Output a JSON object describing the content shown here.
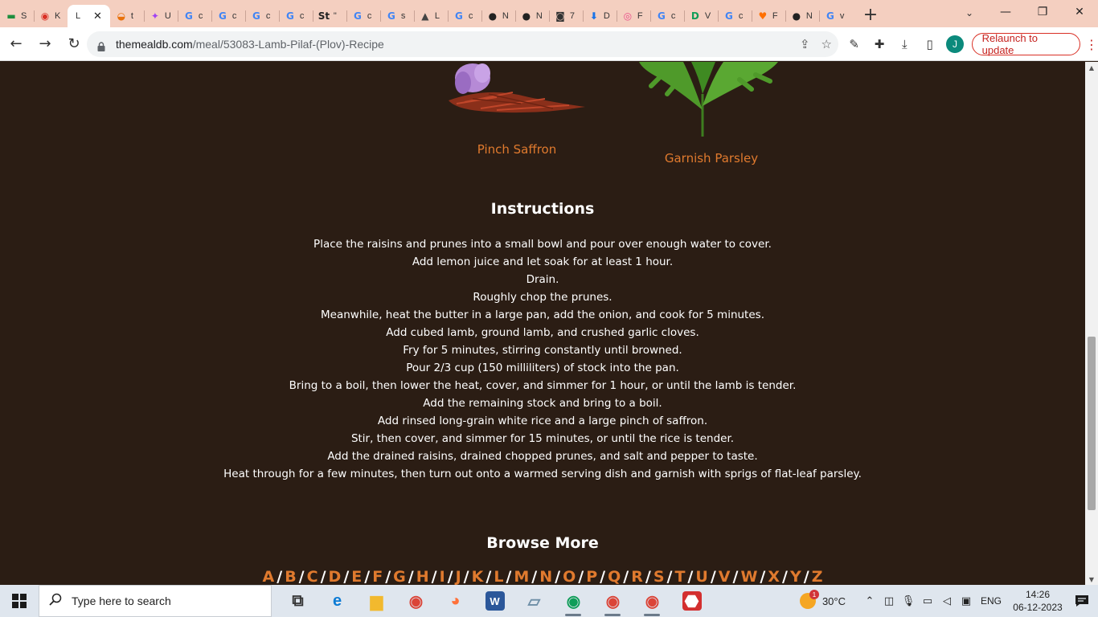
{
  "browser": {
    "tabs": [
      {
        "letter": "S",
        "color": "#1e8e3e",
        "glyph": "▬"
      },
      {
        "letter": "K",
        "color": "#d93025",
        "glyph": "◉"
      },
      {
        "letter": "L",
        "color": "#ffffff",
        "glyph": "",
        "active": true
      },
      {
        "letter": "t",
        "color": "#e8710a",
        "glyph": "◒"
      },
      {
        "letter": "U",
        "color": "#a142f4",
        "glyph": "✦"
      },
      {
        "letter": "c",
        "color": "#4285f4",
        "glyph": "G"
      },
      {
        "letter": "c",
        "color": "#4285f4",
        "glyph": "G"
      },
      {
        "letter": "c",
        "color": "#4285f4",
        "glyph": "G"
      },
      {
        "letter": "c",
        "color": "#4285f4",
        "glyph": "G"
      },
      {
        "letter": "\"",
        "color": "#222222",
        "glyph": "St"
      },
      {
        "letter": "c",
        "color": "#4285f4",
        "glyph": "G"
      },
      {
        "letter": "s",
        "color": "#4285f4",
        "glyph": "G"
      },
      {
        "letter": "L",
        "color": "#444444",
        "glyph": "▲"
      },
      {
        "letter": "c",
        "color": "#4285f4",
        "glyph": "G"
      },
      {
        "letter": "N",
        "color": "#222222",
        "glyph": "●"
      },
      {
        "letter": "N",
        "color": "#222222",
        "glyph": "●"
      },
      {
        "letter": "7",
        "color": "#333333",
        "glyph": "◙"
      },
      {
        "letter": "D",
        "color": "#1a73e8",
        "glyph": "⬇"
      },
      {
        "letter": "F",
        "color": "#ea4c89",
        "glyph": "◎"
      },
      {
        "letter": "c",
        "color": "#4285f4",
        "glyph": "G"
      },
      {
        "letter": "V",
        "color": "#0f9d58",
        "glyph": "D"
      },
      {
        "letter": "c",
        "color": "#4285f4",
        "glyph": "G"
      },
      {
        "letter": "F",
        "color": "#ff6f00",
        "glyph": "♥"
      },
      {
        "letter": "N",
        "color": "#222222",
        "glyph": "●"
      },
      {
        "letter": "v",
        "color": "#4285f4",
        "glyph": "G"
      }
    ],
    "new_tab": "+",
    "url_host": "themealdb.com",
    "url_path": "/meal/53083-Lamb-Pilaf-(Plov)-Recipe",
    "relaunch_label": "Relaunch to update",
    "profile_initial": "J"
  },
  "page": {
    "ingredients": [
      {
        "name": "Pinch Saffron",
        "image": "saffron"
      },
      {
        "name": "Garnish Parsley",
        "image": "parsley"
      }
    ],
    "instructions_title": "Instructions",
    "instructions": [
      "Place the raisins and prunes into a small bowl and pour over enough water to cover.",
      "Add lemon juice and let soak for at least 1 hour.",
      "Drain.",
      "Roughly chop the prunes.",
      "Meanwhile, heat the butter in a large pan, add the onion, and cook for 5 minutes.",
      "Add cubed lamb, ground lamb, and crushed garlic cloves.",
      "Fry for 5 minutes, stirring constantly until browned.",
      "Pour 2/3 cup (150 milliliters) of stock into the pan.",
      "Bring to a boil, then lower the heat, cover, and simmer for 1 hour, or until the lamb is tender.",
      "Add the remaining stock and bring to a boil.",
      "Add rinsed long-grain white rice and a large pinch of saffron.",
      "Stir, then cover, and simmer for 15 minutes, or until the rice is tender.",
      "Add the drained raisins, drained chopped prunes, and salt and pepper to taste.",
      "Heat through for a few minutes, then turn out onto a warmed serving dish and garnish with sprigs of flat-leaf parsley."
    ],
    "browse_title": "Browse More",
    "letters": [
      "A",
      "B",
      "C",
      "D",
      "E",
      "F",
      "G",
      "H",
      "I",
      "J",
      "K",
      "L",
      "M",
      "N",
      "O",
      "P",
      "Q",
      "R",
      "S",
      "T",
      "U",
      "V",
      "W",
      "X",
      "Y",
      "Z"
    ],
    "accent_color": "#e07a2e",
    "background_color": "#2b1d14"
  },
  "taskbar": {
    "search_placeholder": "Type here to search",
    "weather_temp": "30°C",
    "weather_badge": "1",
    "language": "ENG",
    "time": "14:26",
    "date": "06-12-2023",
    "apps": [
      {
        "name": "task-view",
        "glyph": "⧉",
        "color": "#333333",
        "open": false
      },
      {
        "name": "edge",
        "glyph": "e",
        "color": "#0c7bd4",
        "open": false
      },
      {
        "name": "file-explorer",
        "glyph": "▆",
        "color": "#f2b92e",
        "open": false
      },
      {
        "name": "chrome",
        "glyph": "◉",
        "color": "#db4437",
        "open": false
      },
      {
        "name": "firefox",
        "glyph": "◕",
        "color": "#ff7139",
        "open": false
      },
      {
        "name": "word",
        "glyph": "W",
        "color": "#2b579a",
        "open": false
      },
      {
        "name": "app",
        "glyph": "▱",
        "color": "#6d8ea6",
        "open": false
      },
      {
        "name": "chrome-profile-1",
        "glyph": "◉",
        "color": "#0f9d58",
        "open": true
      },
      {
        "name": "chrome-profile-2",
        "glyph": "◉",
        "color": "#db4437",
        "open": true
      },
      {
        "name": "chrome-profile-3",
        "glyph": "◉",
        "color": "#db4437",
        "open": true
      },
      {
        "name": "acrobat",
        "glyph": "⬣",
        "color": "#d32f2f",
        "open": false
      }
    ]
  }
}
